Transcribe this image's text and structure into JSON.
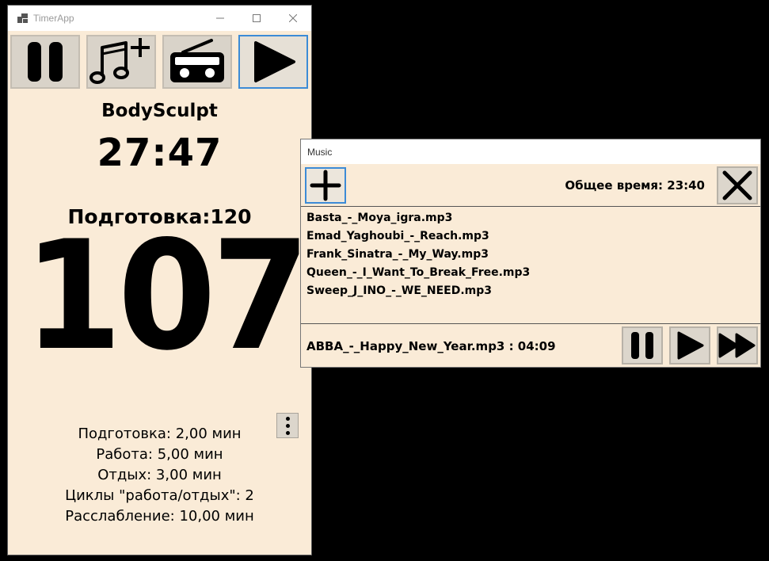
{
  "timer_window": {
    "title": "TimerApp",
    "program_name": "BodySculpt",
    "total_time": "27:47",
    "phase_label": "Подготовка:120",
    "countdown": "107",
    "settings": [
      "Подготовка: 2,00 мин",
      "Работа: 5,00 мин",
      "Отдых: 3,00 мин",
      "Циклы \"работа/отдых\": 2",
      "Расслабление: 10,00 мин"
    ],
    "toolbar_icons": [
      "pause-icon",
      "add-music-icon",
      "radio-icon",
      "play-icon"
    ]
  },
  "music_window": {
    "title": "Music",
    "total_time_label": "Общее время: 23:40",
    "playlist": [
      "Basta_-_Moya_igra.mp3",
      "Emad_Yaghoubi_-_Reach.mp3",
      "Frank_Sinatra_-_My_Way.mp3",
      "Queen_-_I_Want_To_Break_Free.mp3",
      "Sweep_J_INO_-_WE_NEED.mp3"
    ],
    "now_playing": "ABBA_-_Happy_New_Year.mp3 : 04:09"
  },
  "colors": {
    "window_bg": "#faebd7",
    "accent_border": "#3c8bd6",
    "button_bg": "#d9d3c9"
  }
}
